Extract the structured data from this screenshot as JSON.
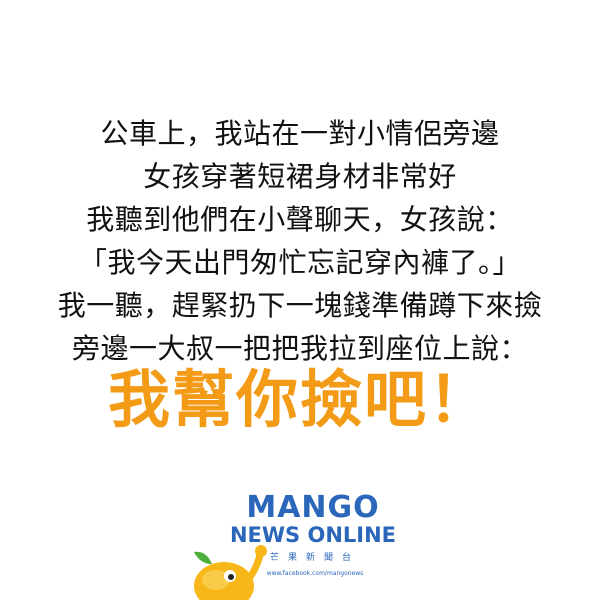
{
  "story": {
    "lines": [
      "公車上，我站在一對小情侶旁邊",
      "女孩穿著短裙身材非常好",
      "我聽到他們在小聲聊天，女孩說：",
      "「我今天出門匆忙忘記穿內褲了。」",
      "我一聽，趕緊扔下一塊錢準備蹲下來撿",
      "旁邊一大叔一把把我拉到座位上說："
    ]
  },
  "punchline": {
    "text": "我幫你撿吧！"
  },
  "logo": {
    "title": "MANGO",
    "subtitle": "NEWS ONLINE",
    "chinese": "芒果新聞台",
    "url": "www.facebook.com/mangonews"
  },
  "colors": {
    "punchline": "#f39a17",
    "brand_blue": "#2a66b9",
    "brand_orange": "#f4a21d",
    "mascot_yellow": "#f7b718"
  },
  "icons": {
    "mascot": "mango-mascot-icon"
  }
}
